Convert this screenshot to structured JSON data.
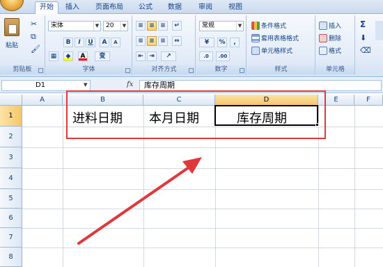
{
  "tabs": [
    "开始",
    "插入",
    "页面布局",
    "公式",
    "数据",
    "审阅",
    "视图"
  ],
  "clipboard": {
    "paste_label": "粘贴",
    "group_label": "剪贴板"
  },
  "font": {
    "name_value": "宋体",
    "size_value": "20",
    "bold_label": "B",
    "italic_label": "I",
    "underline_label": "U",
    "grow_label": "A",
    "shrink_label": "A",
    "font_color_label": "A",
    "phonetic_label": "变",
    "group_label": "字体"
  },
  "alignment": {
    "group_label": "对齐方式"
  },
  "number": {
    "format_value": "常规",
    "percent_label": "%",
    "comma_label": ",",
    "group_label": "数字"
  },
  "styles": {
    "conditional_label": "条件格式",
    "table_label": "套用表格格式",
    "cell_styles_label": "单元格样式",
    "group_label": "样式"
  },
  "cells_group": {
    "insert_label": "插入",
    "delete_label": "删除",
    "format_label": "格式",
    "group_label": "单元格"
  },
  "editing": {
    "sigma_label": "Σ"
  },
  "formula_bar": {
    "name_box": "D1",
    "fx_label": "fx",
    "formula": "库存周期"
  },
  "grid": {
    "columns": [
      "A",
      "B",
      "C",
      "D",
      "E",
      "F"
    ],
    "rows": [
      "1",
      "2",
      "3",
      "4",
      "5",
      "6",
      "7",
      "8"
    ],
    "cells": {
      "B1": "进料日期",
      "C1": "本月日期",
      "D1": "库存周期"
    }
  },
  "colors": {
    "annotation_red": "#e0383a",
    "ribbon_text": "#15428b",
    "selected_header": "#f6c66a"
  },
  "icons": [
    "office-orb-icon",
    "paste-icon",
    "cut-icon",
    "copy-icon",
    "format-painter-icon",
    "fx-icon",
    "red-arrow-annotation"
  ]
}
